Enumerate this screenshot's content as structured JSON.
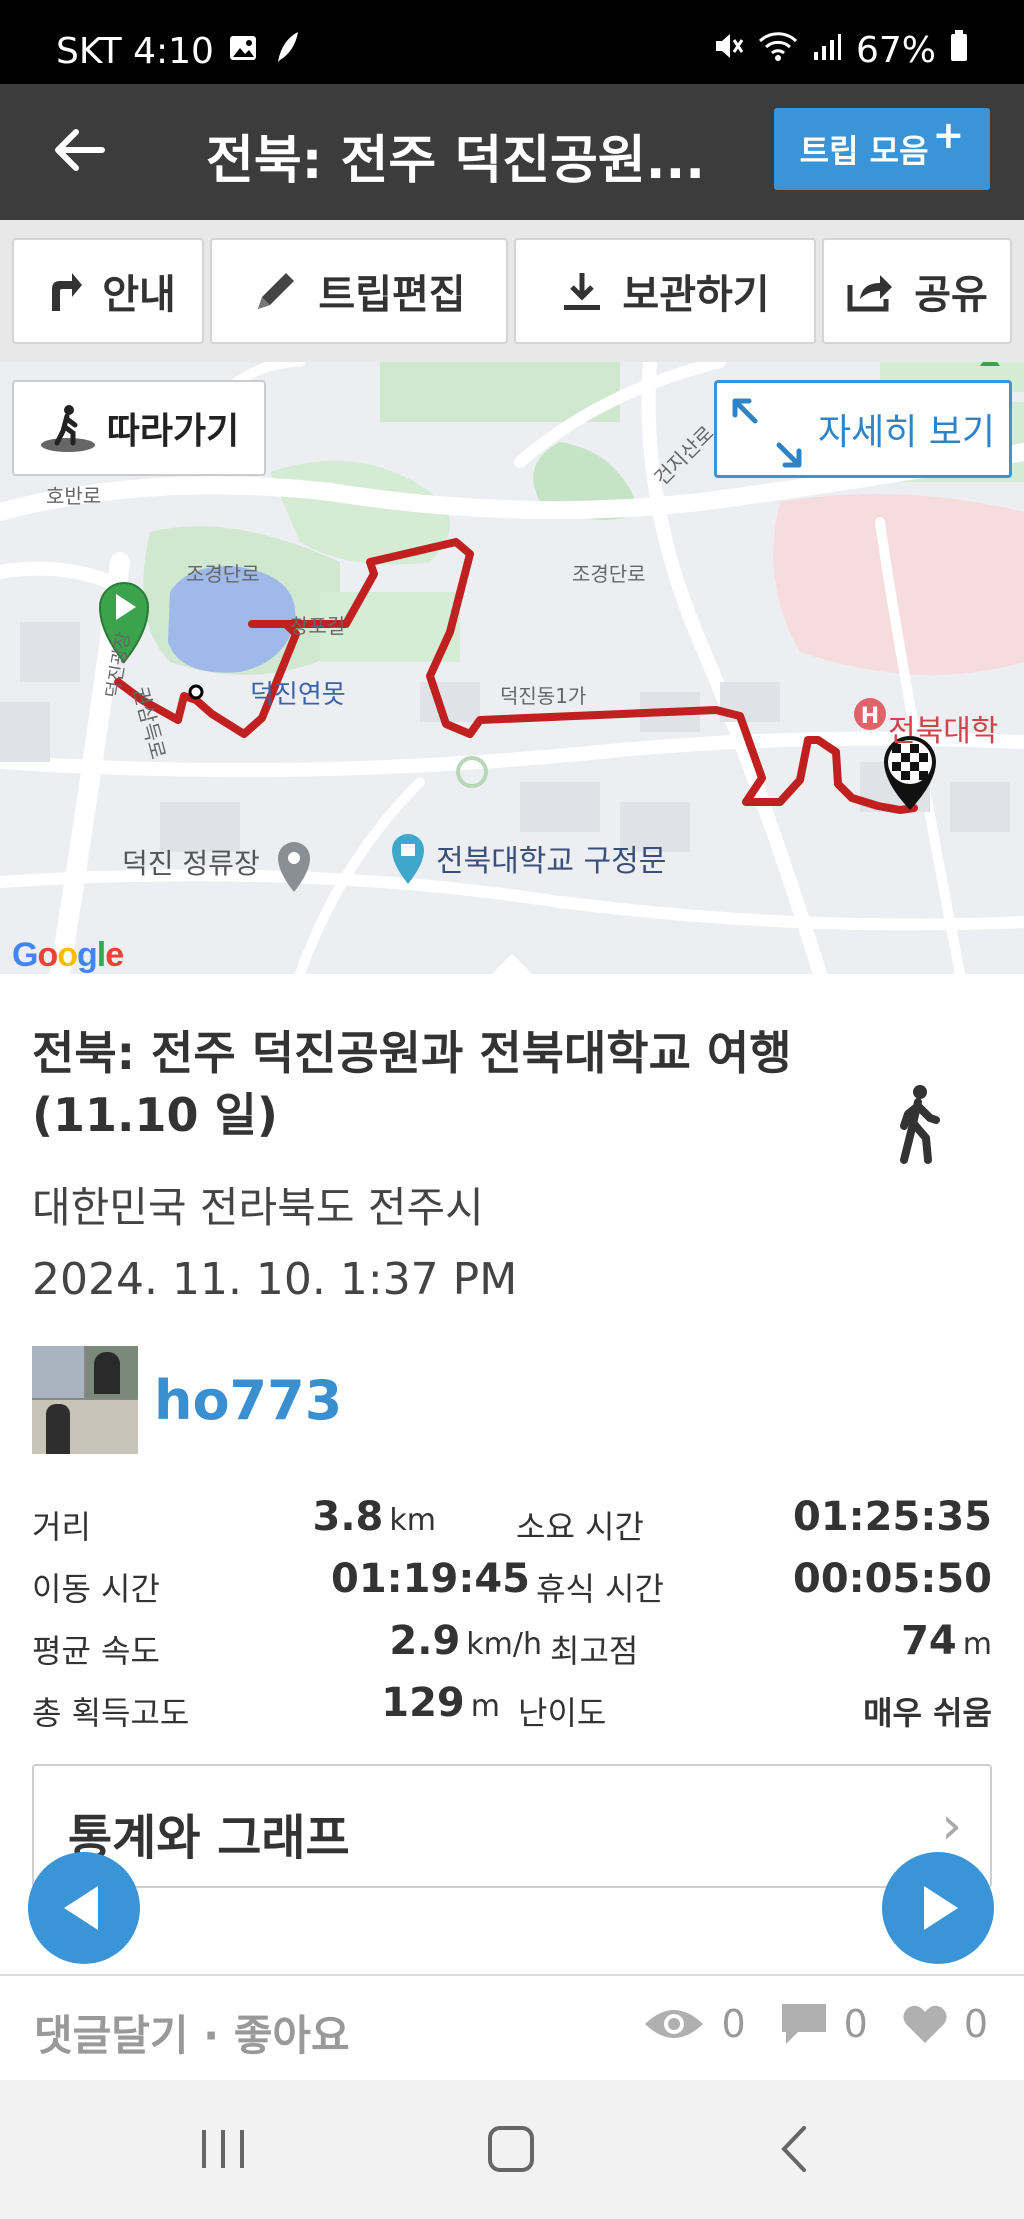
{
  "status_bar": {
    "carrier_time": "SKT 4:10",
    "battery": "67%"
  },
  "header": {
    "title": "전북: 전주 덕진공원...",
    "trip_collect_label": "트립 모음",
    "trip_collect_plus": "+"
  },
  "toolbar": {
    "guide_label": "안내",
    "edit_label": "트립편집",
    "save_label": "보관하기",
    "share_label": "공유"
  },
  "map": {
    "follow_label": "따라가기",
    "detail_label": "자세히 보기",
    "labels": {
      "lake": "덕진연못",
      "bus_stop": "덕진 정류장",
      "univ_gate": "전북대학교 구정문",
      "hospital": "전북대학",
      "jogyeong_1": "조경단로",
      "jogyeong_2": "조경단로",
      "geonji": "건지산로",
      "dukjin1ga": "덕진동1가",
      "gwonsam": "권삼득로",
      "hoban": "호반로",
      "champo": "창포길",
      "deokjin_gwangjang": "덕진광장"
    },
    "google": [
      "G",
      "o",
      "o",
      "g",
      "l",
      "e"
    ]
  },
  "trip": {
    "title": "전북: 전주 덕진공원과 전북대학교 여행(11.10 일)",
    "location": "대한민국 전라북도 전주시",
    "datetime": "2024. 11. 10. 1:37 PM",
    "username": "ho773"
  },
  "stats": {
    "distance_label": "거리",
    "distance_value": "3.8",
    "distance_unit": "km",
    "duration_label": "소요 시간",
    "duration_value": "01:25:35",
    "moving_label": "이동 시간",
    "moving_value": "01:19:45",
    "rest_label": "휴식 시간",
    "rest_value": "00:05:50",
    "avg_speed_label": "평균 속도",
    "avg_speed_value": "2.9",
    "avg_speed_unit": "km/h",
    "max_elev_label": "최고점",
    "max_elev_value": "74",
    "max_elev_unit": "m",
    "gain_label": "총 획득고도",
    "gain_value": "129",
    "gain_unit": "m",
    "difficulty_label": "난이도",
    "difficulty_value": "매우 쉬움"
  },
  "stats_card": {
    "title": "통계와 그래프",
    "chevron": "›"
  },
  "footer": {
    "comment_like": "댓글달기 · 좋아요",
    "views": "0",
    "comments": "0",
    "likes": "0"
  },
  "colors": {
    "accent": "#3a94d8",
    "header_bg": "#3c3c3c",
    "route": "#c0201f",
    "username": "#3a8fd1"
  }
}
